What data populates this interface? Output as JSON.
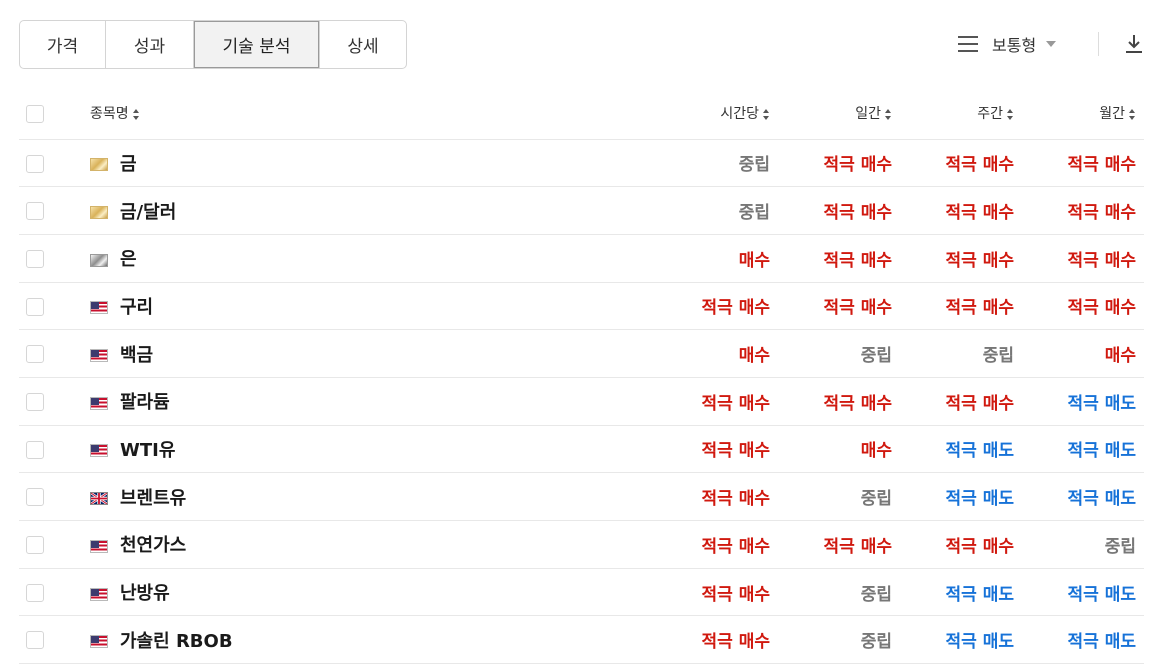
{
  "tabs": [
    {
      "label": "가격",
      "active": false
    },
    {
      "label": "성과",
      "active": false
    },
    {
      "label": "기술 분석",
      "active": true
    },
    {
      "label": "상세",
      "active": false
    }
  ],
  "view": {
    "label": "보통형",
    "icon": "hamburger-icon"
  },
  "download_icon": "download-icon",
  "columns": {
    "name": "종목명",
    "hourly": "시간당",
    "daily": "일간",
    "weekly": "주간",
    "monthly": "월간"
  },
  "colors": {
    "buy": "#d0190f",
    "sell": "#1672d8",
    "neutral": "#777777"
  },
  "rows": [
    {
      "flag": "gold",
      "name": "금",
      "hourly": "중립",
      "daily": "적극 매수",
      "weekly": "적극 매수",
      "monthly": "적극 매수"
    },
    {
      "flag": "gold",
      "name": "금/달러",
      "hourly": "중립",
      "daily": "적극 매수",
      "weekly": "적극 매수",
      "monthly": "적극 매수"
    },
    {
      "flag": "silver",
      "name": "은",
      "hourly": "매수",
      "daily": "적극 매수",
      "weekly": "적극 매수",
      "monthly": "적극 매수"
    },
    {
      "flag": "us",
      "name": "구리",
      "hourly": "적극 매수",
      "daily": "적극 매수",
      "weekly": "적극 매수",
      "monthly": "적극 매수"
    },
    {
      "flag": "us",
      "name": "백금",
      "hourly": "매수",
      "daily": "중립",
      "weekly": "중립",
      "monthly": "매수"
    },
    {
      "flag": "us",
      "name": "팔라듐",
      "hourly": "적극 매수",
      "daily": "적극 매수",
      "weekly": "적극 매수",
      "monthly": "적극 매도"
    },
    {
      "flag": "us",
      "name": "WTI유",
      "hourly": "적극 매수",
      "daily": "매수",
      "weekly": "적극 매도",
      "monthly": "적극 매도"
    },
    {
      "flag": "uk",
      "name": "브렌트유",
      "hourly": "적극 매수",
      "daily": "중립",
      "weekly": "적극 매도",
      "monthly": "적극 매도"
    },
    {
      "flag": "us",
      "name": "천연가스",
      "hourly": "적극 매수",
      "daily": "적극 매수",
      "weekly": "적극 매수",
      "monthly": "중립"
    },
    {
      "flag": "us",
      "name": "난방유",
      "hourly": "적극 매수",
      "daily": "중립",
      "weekly": "적극 매도",
      "monthly": "적극 매도"
    },
    {
      "flag": "us",
      "name": "가솔린 RBOB",
      "hourly": "적극 매수",
      "daily": "중립",
      "weekly": "적극 매도",
      "monthly": "적극 매도"
    }
  ]
}
